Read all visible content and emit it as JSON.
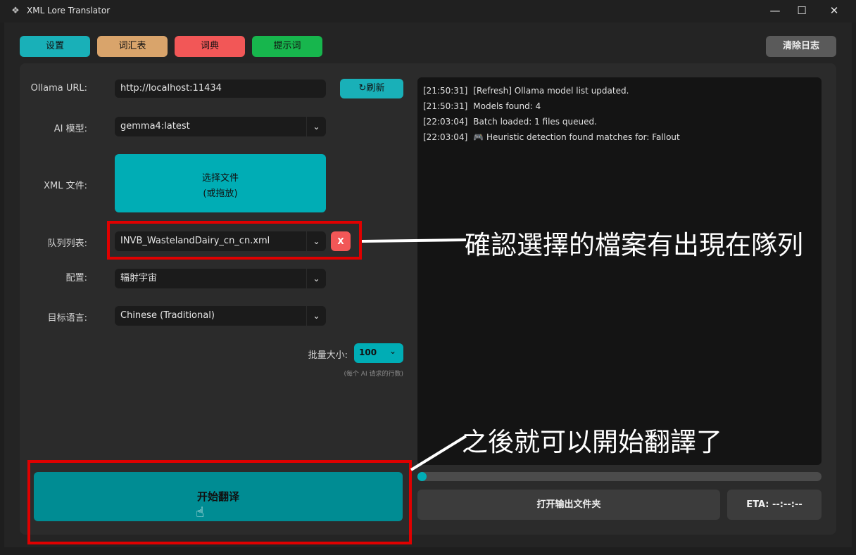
{
  "window": {
    "title": "XML Lore Translator",
    "minimize_icon": "minimize-icon",
    "maximize_icon": "maximize-icon",
    "close_icon": "close-icon"
  },
  "toolbar": {
    "settings": "设置",
    "vocabulary": "词汇表",
    "dictionary": "词典",
    "prompts": "提示词",
    "clear_log": "清除日志",
    "colors": {
      "settings": "#19b0b8",
      "vocabulary": "#d9a46b",
      "dictionary": "#f25757",
      "prompts": "#17b64d",
      "clear_log": "#5a5a5a"
    }
  },
  "form": {
    "ollama_url_label": "Ollama URL:",
    "ollama_url_value": "http://localhost:11434",
    "refresh_label": "刷新",
    "refresh_icon": "refresh-icon",
    "model_label": "AI 模型:",
    "model_value": "gemma4:latest",
    "xml_label": "XML 文件:",
    "choose_file_line1": "选择文件",
    "choose_file_line2": "(或拖放)",
    "queue_label": "队列列表:",
    "queue_value": "INVB_WastelandDairy_cn_cn.xml",
    "remove_label": "X",
    "profile_label": "配置:",
    "profile_value": "辐射宇宙",
    "target_lang_label": "目标语言:",
    "target_lang_value": "Chinese (Traditional)",
    "batch_label": "批量大小:",
    "batch_value": "100",
    "batch_hint": "(每个 AI 请求的行数)",
    "start_label": "开始翻译"
  },
  "log": {
    "lines": [
      {
        "time": "[21:50:31]",
        "text": "[Refresh] Ollama model list updated."
      },
      {
        "time": "[21:50:31]",
        "text": "Models found: 4"
      },
      {
        "time": "[22:03:04]",
        "text": "Batch loaded: 1 files queued."
      },
      {
        "time": "[22:03:04]",
        "text": "🎮 Heuristic detection found matches for: Fallout"
      }
    ]
  },
  "progress": {
    "fraction": 0.0
  },
  "footer": {
    "open_output": "打开输出文件夹",
    "eta": "ETA: --:--:--"
  },
  "annotations": {
    "queue_note": "確認選擇的檔案有出現在隊列",
    "start_note": "之後就可以開始翻譯了"
  }
}
